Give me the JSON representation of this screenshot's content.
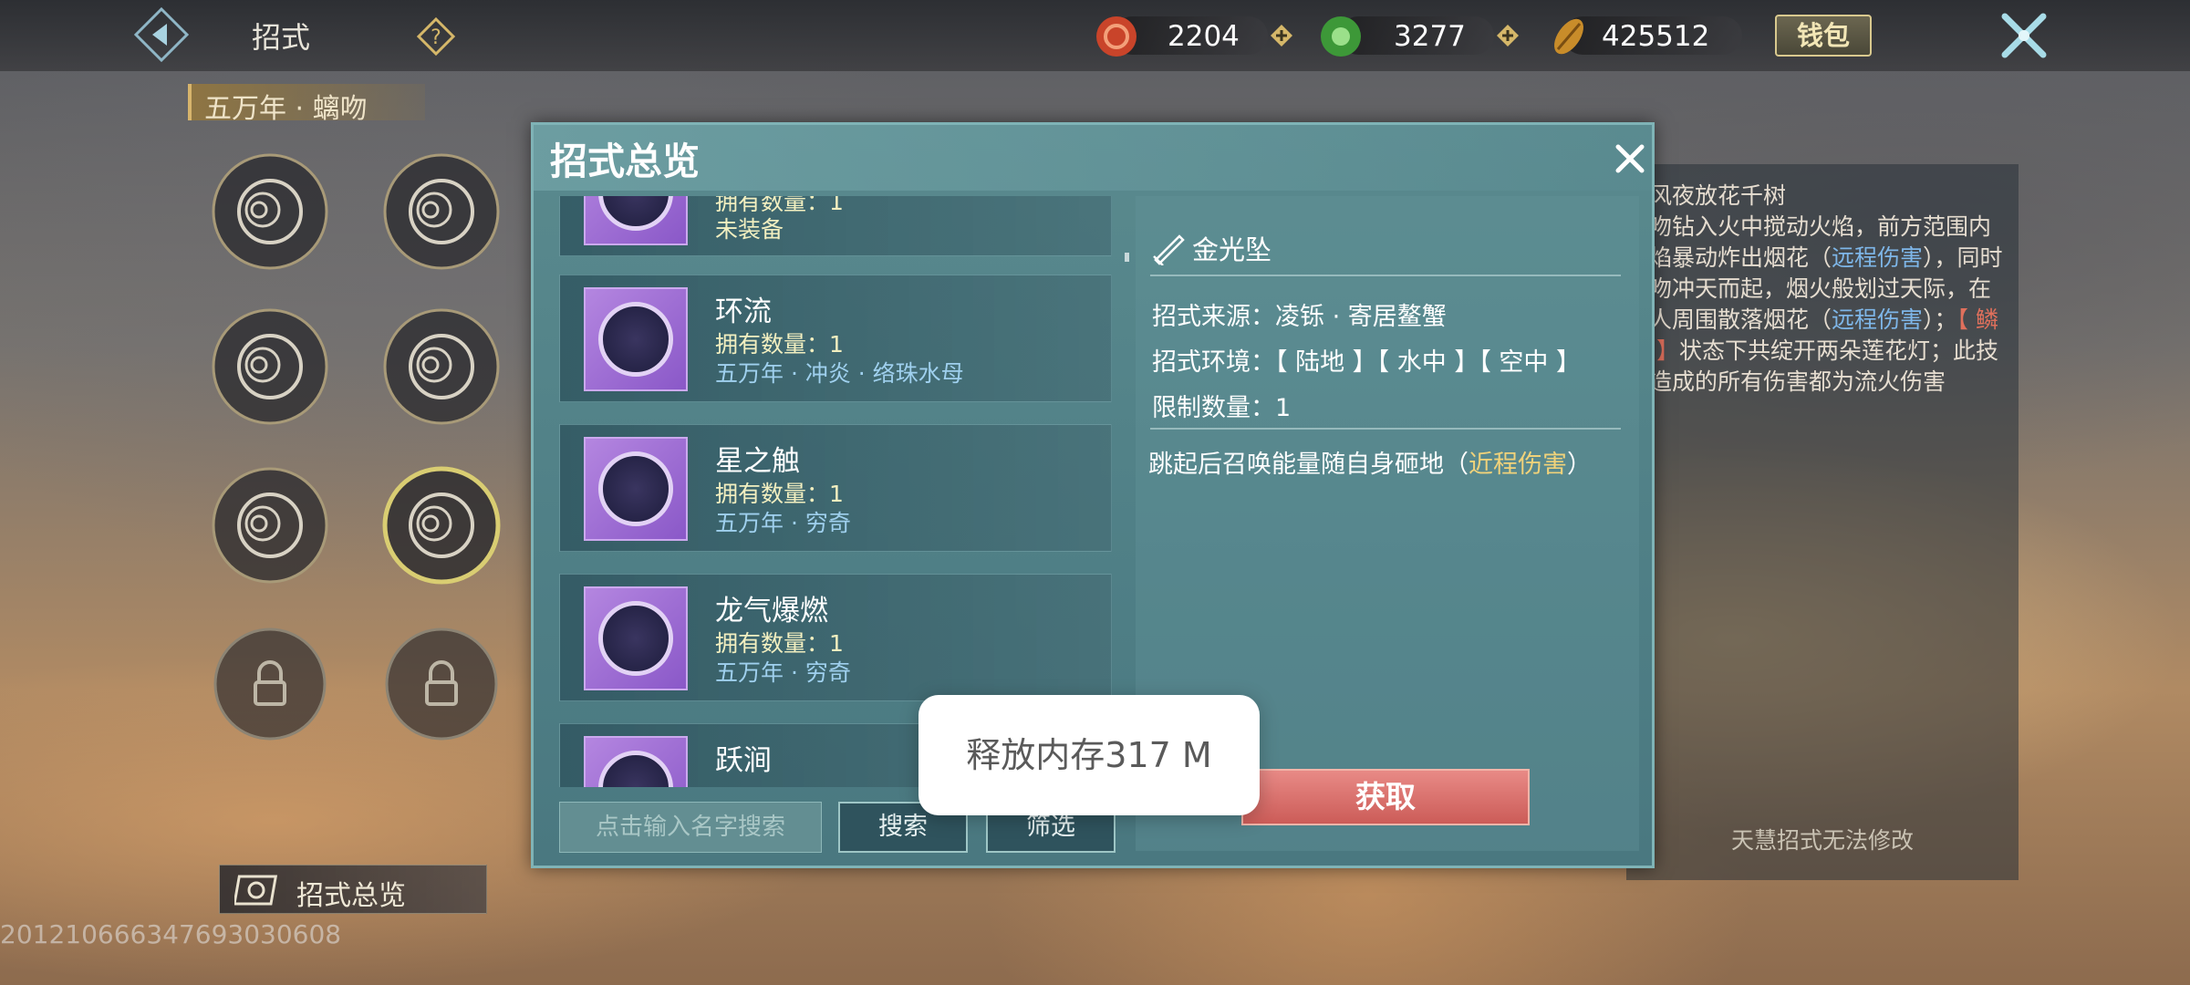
{
  "topbar": {
    "title": "招式",
    "currencies": [
      {
        "name": "red-currency-icon",
        "value": "2204",
        "color": "#d0542c"
      },
      {
        "name": "jade-currency-icon",
        "value": "3277",
        "color": "#3f9a3a"
      },
      {
        "name": "gold-leaf-currency-icon",
        "value": "425512",
        "color": "#c88c2a"
      }
    ],
    "wallet_label": "钱包"
  },
  "left": {
    "header": "五万年 · 螭吻",
    "overview_label": "招式总览",
    "uid": "20121066634769303060​8"
  },
  "dialog": {
    "title": "招式总览",
    "cards": [
      {
        "name": "",
        "count": "拥有数量：1",
        "source": "未装备",
        "source_color": "#f2efc0"
      },
      {
        "name": "环流",
        "count": "拥有数量：1",
        "source": "五万年 · 冲炎 · 络珠水母"
      },
      {
        "name": "星之触",
        "count": "拥有数量：1",
        "source": "五万年 · 穷奇"
      },
      {
        "name": "龙气爆燃",
        "count": "拥有数量：1",
        "source": "五万年 · 穷奇"
      },
      {
        "name": "跃涧",
        "count": "",
        "source": ""
      }
    ],
    "search_placeholder": "点击输入名字搜索",
    "search_label": "搜索",
    "filter_label": "筛选",
    "detail": {
      "name": "金光坠",
      "source": "招式来源：凌铄 · 寄居鳌蟹",
      "environment": "招式环境：【 陆地 】【 水中 】【 空中 】",
      "limit": "限制数量：1",
      "desc_prefix": "跳起后召唤能量随自身砸地（",
      "desc_highlight": "近程伤害",
      "desc_suffix": "）"
    },
    "get_label": "获取"
  },
  "side_desc": {
    "line1": "东风夜放花千树",
    "body_a": "螭吻钻入火中搅动火焰，前方范围内火焰暴动炸出烟花（",
    "hl1": "远程伤害",
    "body_b": "），同时螭吻冲天而起，烟火般划过天际，在敌人周围散落烟花（",
    "hl2": "远程伤害",
    "body_c": "）；",
    "hl3": "【 鳞甲 】",
    "body_d": "状态下共绽开两朵莲花灯；此技能造成的所有伤害都为流火伤害",
    "footer": "天慧招式无法修改"
  },
  "toast": "释放内存317 M"
}
